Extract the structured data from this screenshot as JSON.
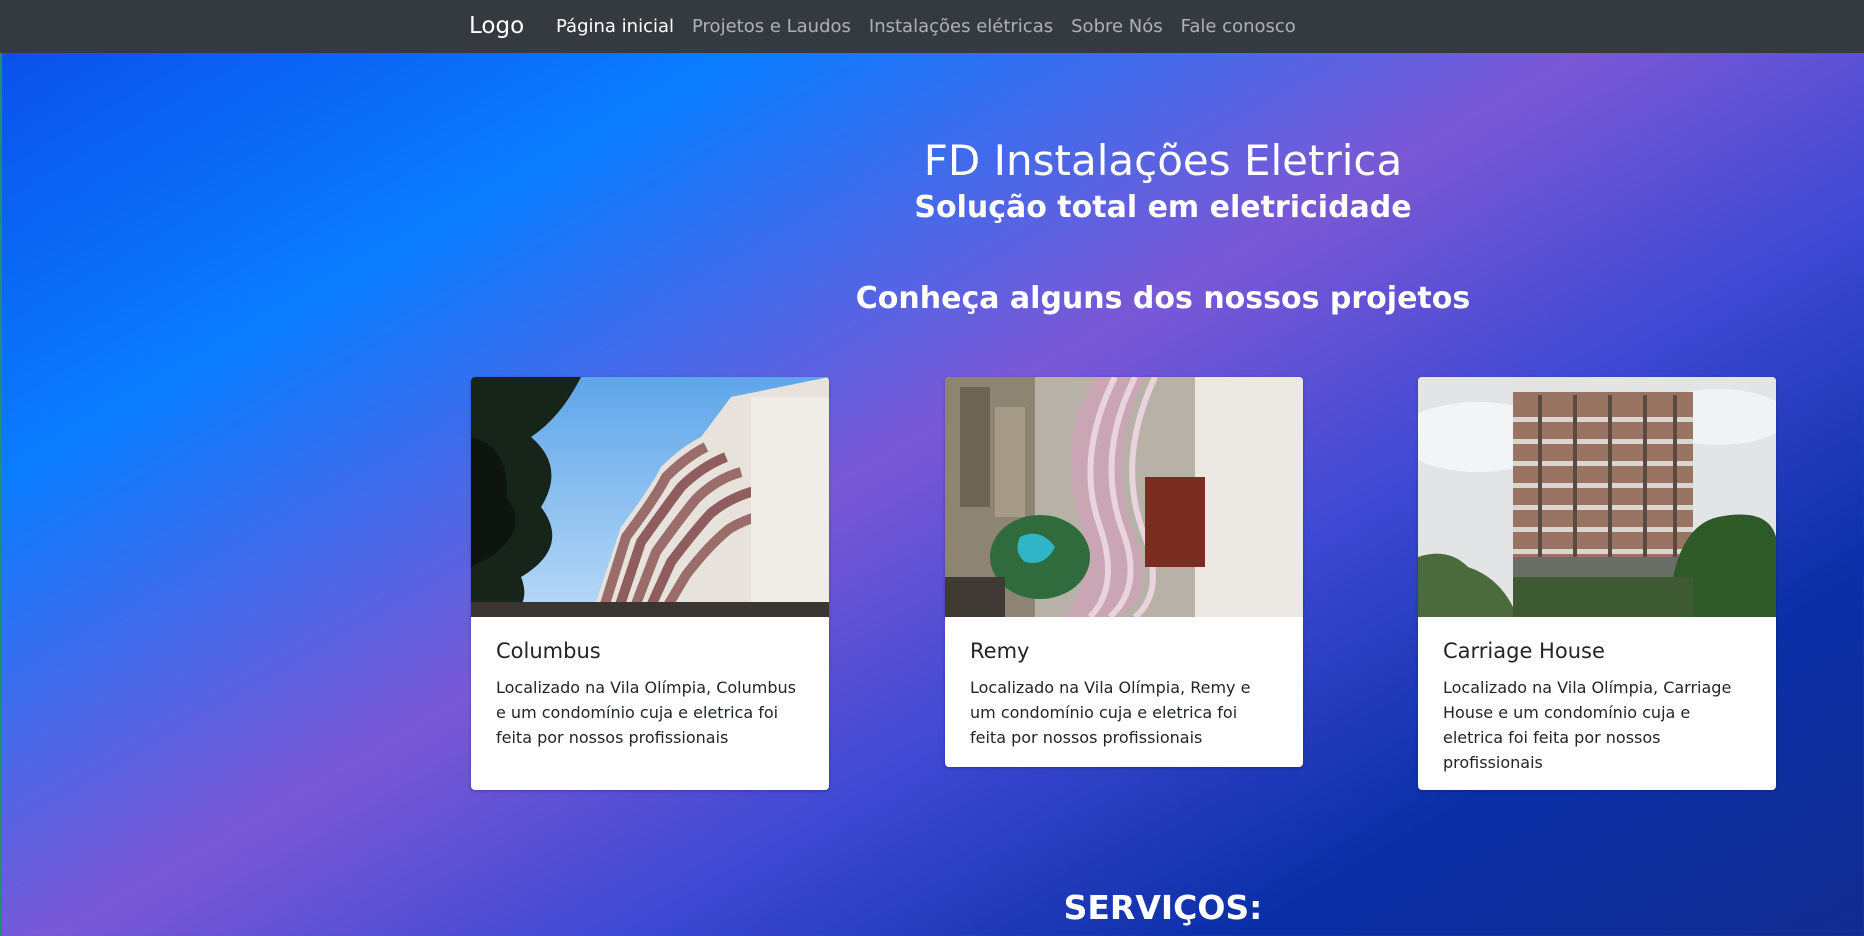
{
  "nav": {
    "logo": "Logo",
    "links": [
      "Página inicial",
      "Projetos e Laudos",
      "Instalações elétricas",
      "Sobre Nós",
      "Fale conosco"
    ]
  },
  "hero": {
    "title": "FD Instalações Eletrica",
    "subtitle": "Solução total em eletricidade"
  },
  "projects": {
    "heading": "Conheça alguns dos nossos projetos",
    "cards": [
      {
        "title": "Columbus",
        "text": "Localizado na Vila Olímpia, Columbus e um condomínio cuja e eletrica foi feita por nossos profissionais"
      },
      {
        "title": "Remy",
        "text": "Localizado na Vila Olímpia, Remy e um condomínio cuja e eletrica foi feita por nossos profissionais"
      },
      {
        "title": "Carriage House",
        "text": "Localizado na Vila Olímpia, Carriage House e um condomínio cuja e eletrica foi feita por nossos profissionais"
      }
    ]
  },
  "services": {
    "heading": "SERVIÇOS:"
  }
}
